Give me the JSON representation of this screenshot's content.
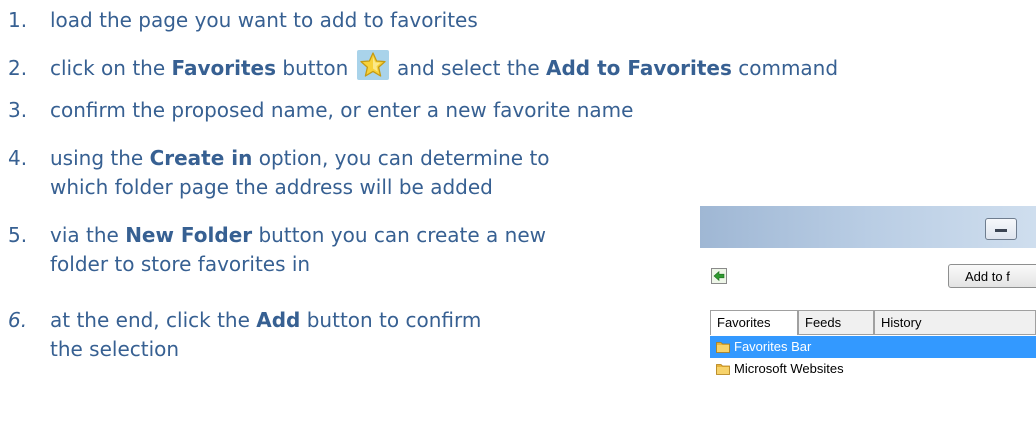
{
  "steps": [
    {
      "num": "1.",
      "parts": [
        "load the page you want to add to favorites"
      ]
    },
    {
      "num": "2.",
      "parts": [
        "click on the ",
        "Favorites",
        " button",
        " and select the ",
        "Add to Favorites",
        " command"
      ]
    },
    {
      "num": "3.",
      "parts": [
        "confirm the proposed name, or enter a new favorite name"
      ]
    },
    {
      "num": "4.",
      "parts": [
        "using the ",
        "Create in",
        " option, you can determine to",
        "which folder page the address will be added"
      ]
    },
    {
      "num": "5.",
      "parts": [
        "via the ",
        "New Folder",
        " button you can create a new",
        "folder to store favorites in"
      ]
    },
    {
      "num": "6.",
      "parts": [
        "at the end, click the ",
        "Add",
        " button to confirm",
        "the selection"
      ]
    }
  ],
  "icons": {
    "favorites_star": "star-icon",
    "back": "back-arrow-icon",
    "folder": "folder-icon",
    "minimize": "minimize-icon"
  },
  "colors": {
    "step_text": "#376092",
    "star_bg": "#a9d3ea",
    "selection": "#3399ff"
  },
  "dialog": {
    "add_button_label": "Add to f",
    "tabs": [
      "Favorites",
      "Feeds",
      "History"
    ],
    "items": [
      {
        "label": "Favorites Bar",
        "selected": true
      },
      {
        "label": "Microsoft Websites",
        "selected": false
      }
    ]
  }
}
